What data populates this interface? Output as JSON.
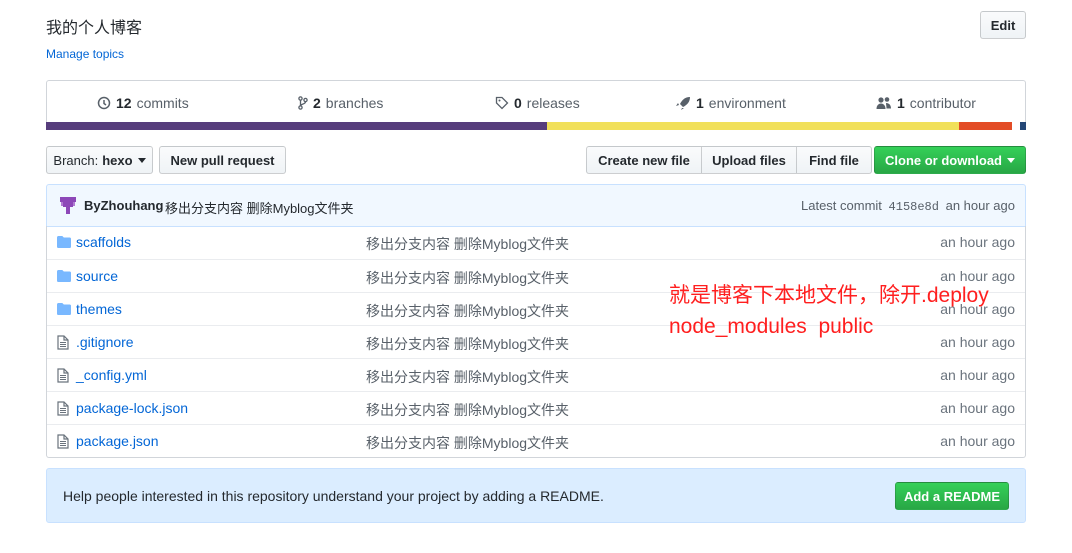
{
  "repo": {
    "description": "我的个人博客",
    "manage_topics": "Manage topics",
    "edit_label": "Edit"
  },
  "summary": {
    "commits": {
      "count": "12",
      "label": "commits",
      "icon": "history-icon"
    },
    "branches": {
      "count": "2",
      "label": "branches",
      "icon": "branch-icon"
    },
    "releases": {
      "count": "0",
      "label": "releases",
      "icon": "tag-icon"
    },
    "environment": {
      "count": "1",
      "label": "environment",
      "icon": "rocket-icon"
    },
    "contributor": {
      "count": "1",
      "label": "contributor",
      "icon": "people-icon"
    }
  },
  "languages": [
    {
      "share": 0.514,
      "color": "#563d7c"
    },
    {
      "share": 0.423,
      "color": "#f1e05a"
    },
    {
      "share": 0.055,
      "color": "#e34c26"
    },
    {
      "share": 0.008,
      "color": "#fff"
    },
    {
      "share": 0.006,
      "color": "#244776"
    }
  ],
  "nav": {
    "branch_prefix": "Branch:",
    "branch_name": "hexo",
    "new_pull_request": "New pull request",
    "create_new_file": "Create new file",
    "upload_files": "Upload files",
    "find_file": "Find file",
    "clone_or_download": "Clone or download"
  },
  "commit": {
    "author": "ByZhouhang",
    "message": "移出分支内容 删除Myblog文件夹",
    "latest_label": "Latest commit",
    "sha": "4158e8d",
    "age": "an hour ago"
  },
  "files": [
    {
      "name": "scaffolds",
      "type": "folder",
      "message": "移出分支内容 删除Myblog文件夹",
      "age": "an hour ago"
    },
    {
      "name": "source",
      "type": "folder",
      "message": "移出分支内容 删除Myblog文件夹",
      "age": "an hour ago"
    },
    {
      "name": "themes",
      "type": "folder",
      "message": "移出分支内容 删除Myblog文件夹",
      "age": "an hour ago"
    },
    {
      "name": ".gitignore",
      "type": "file",
      "message": "移出分支内容 删除Myblog文件夹",
      "age": "an hour ago"
    },
    {
      "name": "_config.yml",
      "type": "file",
      "message": "移出分支内容 删除Myblog文件夹",
      "age": "an hour ago"
    },
    {
      "name": "package-lock.json",
      "type": "file",
      "message": "移出分支内容 删除Myblog文件夹",
      "age": "an hour ago"
    },
    {
      "name": "package.json",
      "type": "file",
      "message": "移出分支内容 删除Myblog文件夹",
      "age": "an hour ago"
    }
  ],
  "annotation": {
    "line1": "就是博客下本地文件，除开.deploy",
    "line2": "node_modules  public",
    "color": "#ff1f1f"
  },
  "readme": {
    "text": "Help people interested in this repository understand your project by adding a README.",
    "button": "Add a README"
  }
}
